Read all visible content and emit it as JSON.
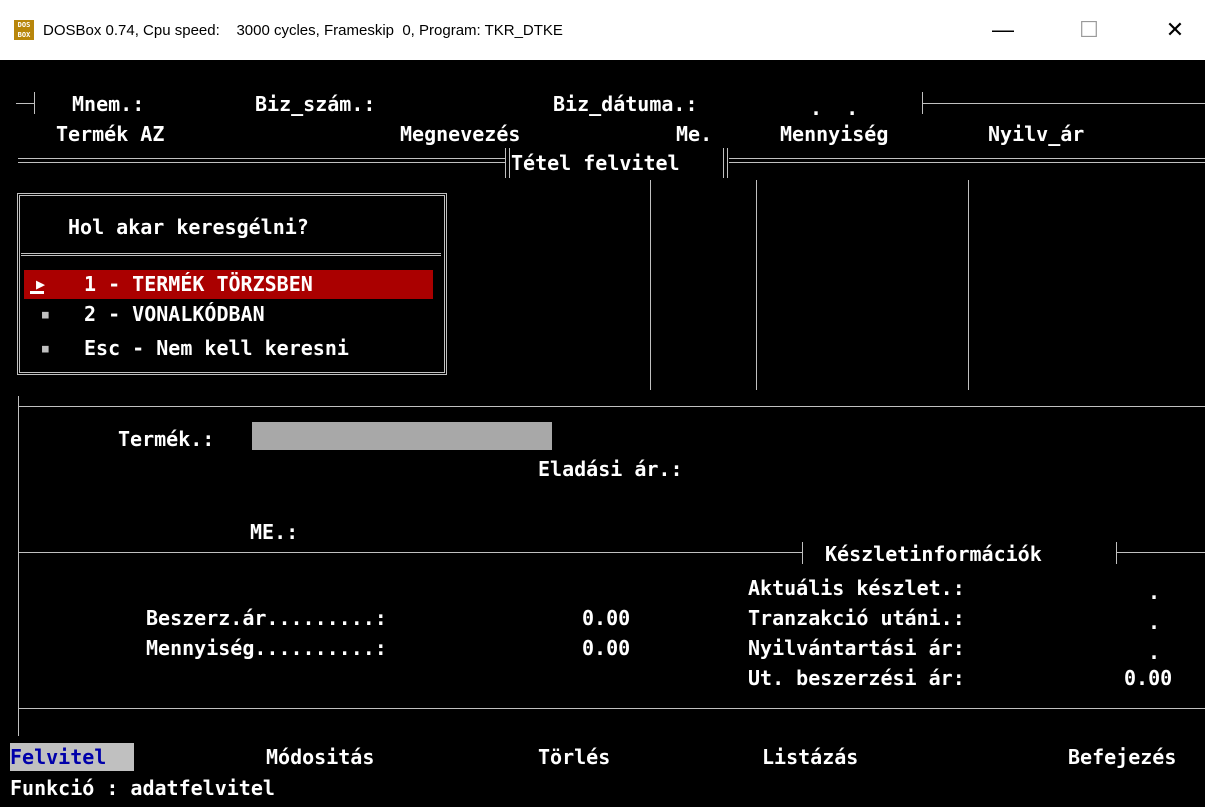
{
  "window": {
    "title": "DOSBox 0.74, Cpu speed:    3000 cycles, Frameskip  0, Program: TKR_DTKE",
    "minimize": "—",
    "maximize": "☐",
    "close": "✕"
  },
  "header": {
    "mnem": "Mnem.:",
    "biz_szam": "Biz_szám.:",
    "biz_datuma": "Biz_dátuma.:",
    "date_value": ".  .",
    "columns": [
      "Termék AZ",
      "Megnevezés",
      "Me.",
      "Mennyiség",
      "Nyilv_ár"
    ],
    "section_title": "Tétel felvitel"
  },
  "search_dialog": {
    "question": "Hol akar keresgélni?",
    "options": [
      {
        "marker": "▶",
        "label": "1 - TERMÉK TÖRZSBEN"
      },
      {
        "marker": "■",
        "label": "2 - VONALKÓDBAN"
      },
      {
        "marker": "■",
        "label": "Esc - Nem kell keresni"
      }
    ]
  },
  "form": {
    "termek_label": "Termék.:",
    "termek_value": "",
    "eladasi_ar_label": "Eladási ár.:",
    "me_label": "ME.:"
  },
  "purchase": {
    "beszerz_label": "Beszerz.ár.........:",
    "beszerz_value": "0.00",
    "mennyiseg_label": "Mennyiség..........:",
    "mennyiseg_value": "0.00"
  },
  "stock_info": {
    "title": "Készletinformációk",
    "rows": [
      {
        "label": "Aktuális készlet.:",
        "value": "."
      },
      {
        "label": "Tranzakció utáni.:",
        "value": "."
      },
      {
        "label": "Nyilvántartási ár:",
        "value": "."
      },
      {
        "label": "Ut. beszerzési ár:",
        "value": "0.00"
      }
    ]
  },
  "function_menu": [
    "Felvitel",
    "Módositás",
    "Törlés",
    "Listázás",
    "Befejezés"
  ],
  "status": "Funkció : adatfelvitel",
  "colors": {
    "highlight_red": "#aa0000",
    "menu_select_blue": "#0000aa",
    "field_gray": "#a8a8a8"
  }
}
